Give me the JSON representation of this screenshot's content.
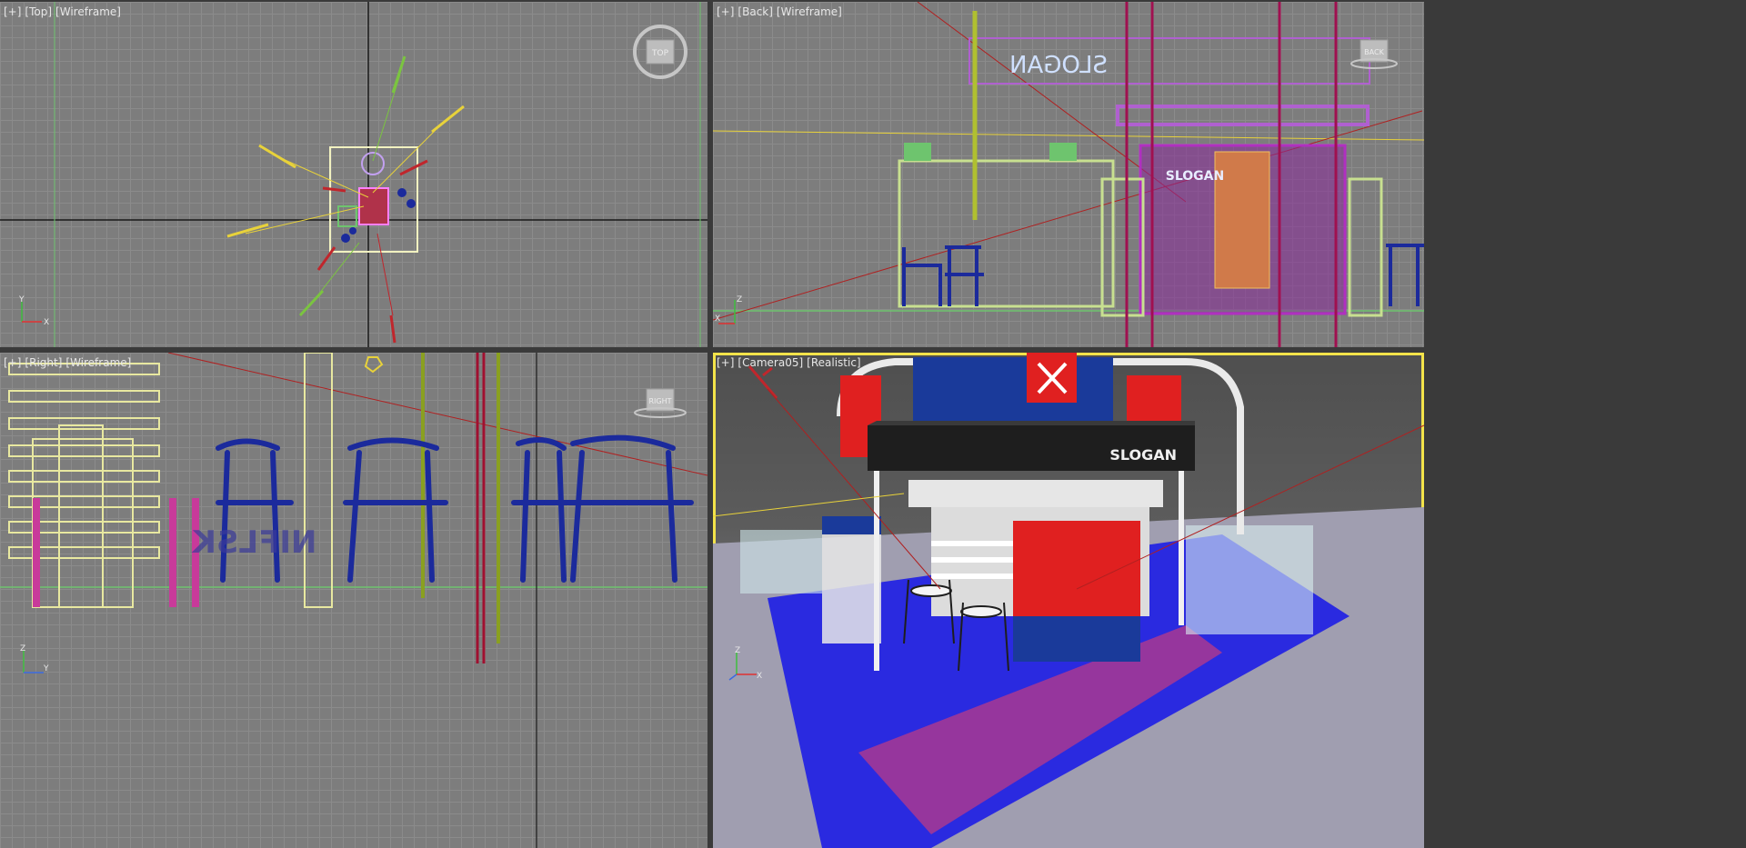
{
  "viewports": {
    "top": {
      "plus": "[+]",
      "view": "[Top]",
      "mode": "[Wireframe]",
      "cube_label": "TOP",
      "axis": {
        "a": "Y",
        "b": "X"
      }
    },
    "back": {
      "plus": "[+]",
      "view": "[Back]",
      "mode": "[Wireframe]",
      "cube_label": "BACK",
      "axis": {
        "a": "Z",
        "b": "X"
      },
      "slogan_mirrored": "SLOGAN",
      "slogan_panel": "SLOGAN"
    },
    "right": {
      "plus": "[+]",
      "view": "[Right]",
      "mode": "[Wireframe]",
      "cube_label": "RIGHT",
      "axis": {
        "a": "Z",
        "b": "Y"
      },
      "mirrored_text": "NIFLSK"
    },
    "camera": {
      "plus": "[+]",
      "view": "[Camera05]",
      "mode": "[Realistic]",
      "axis": {
        "a": "Z",
        "b": "X"
      },
      "slogan": "SLOGAN"
    }
  },
  "colors": {
    "active_border": "#f3e34a",
    "grid": "#8b8b8b",
    "viewport_bg": "#7d7d7d"
  }
}
